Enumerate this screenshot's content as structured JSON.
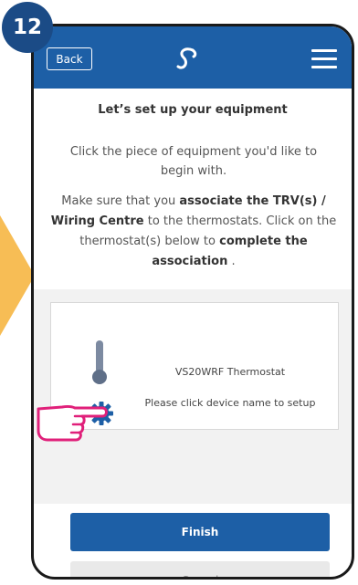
{
  "step": {
    "number": "12"
  },
  "header": {
    "back_label": "Back",
    "logo_icon": "salus-logo-icon",
    "menu_icon": "hamburger-menu-icon"
  },
  "content": {
    "title": "Let’s set up your equipment",
    "intro": "Click the piece of equipment you'd like to begin with.",
    "assoc_prefix": "Make sure that you ",
    "assoc_bold1": "associate the TRV(s) / Wiring Centre",
    "assoc_mid": " to the thermostats. Click on the thermostat(s) below to ",
    "assoc_bold2": "complete the association",
    "assoc_suffix": " ."
  },
  "device": {
    "name": "VS20WRF Thermostat",
    "setup_hint": "Please click device name to setup",
    "icon": "thermometer-icon",
    "settings_icon": "gear-icon"
  },
  "buttons": {
    "finish_label": "Finish",
    "cancel_label": "Cancel"
  },
  "colors": {
    "primary": "#1d5fa6",
    "badge": "#1b4b86",
    "arrow": "#f7bd55",
    "pointer": "#e0207a"
  }
}
